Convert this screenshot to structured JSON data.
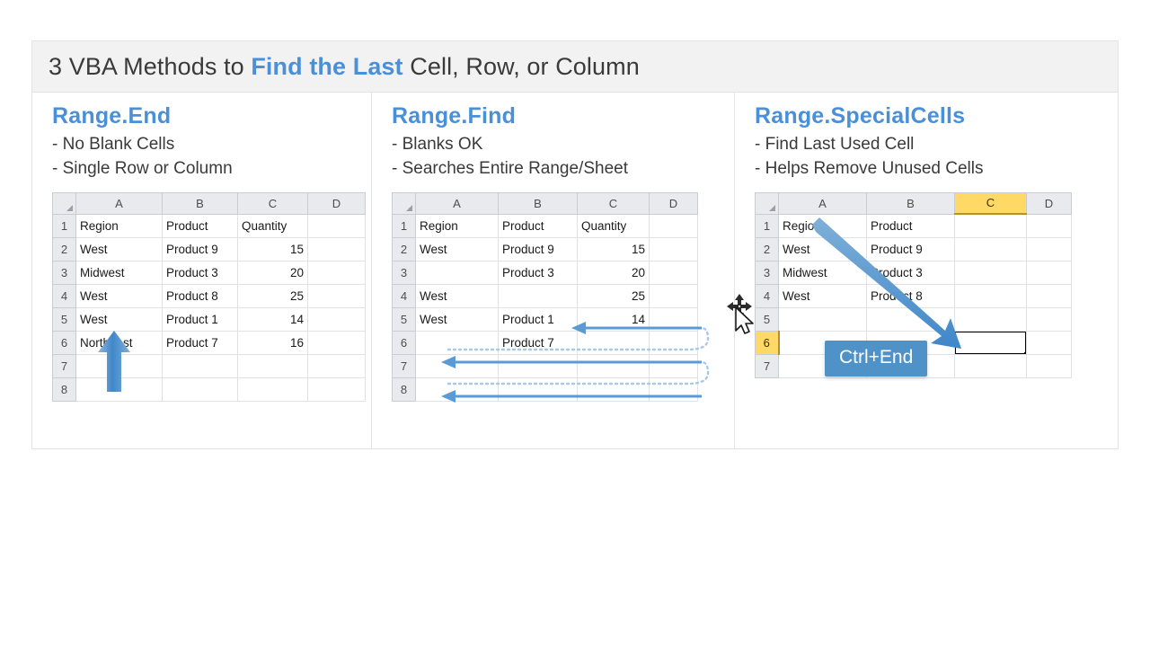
{
  "header": {
    "title_part1": "3 VBA Methods to ",
    "title_highlight": "Find the Last",
    "title_part2": " Cell, Row, or Column"
  },
  "panels": [
    {
      "id": "range-end",
      "title": "Range.End",
      "bullets": [
        "- No Blank Cells",
        "- Single Row or Column"
      ],
      "sheet": {
        "columns": [
          "A",
          "B",
          "C",
          "D"
        ],
        "rows": [
          "1",
          "2",
          "3",
          "4",
          "5",
          "6",
          "7",
          "8"
        ],
        "cells": [
          [
            "Region",
            "Product",
            "Quantity",
            ""
          ],
          [
            "West",
            "Product 9",
            "15",
            ""
          ],
          [
            "Midwest",
            "Product 3",
            "20",
            ""
          ],
          [
            "West",
            "Product 8",
            "25",
            ""
          ],
          [
            "West",
            "Product 1",
            "14",
            ""
          ],
          [
            "Northeast",
            "Product 7",
            "16",
            ""
          ],
          [
            "",
            "",
            "",
            ""
          ],
          [
            "",
            "",
            "",
            ""
          ]
        ]
      },
      "annotation": "up-arrow-column-a"
    },
    {
      "id": "range-find",
      "title": "Range.Find",
      "bullets": [
        "- Blanks OK",
        "- Searches Entire Range/Sheet"
      ],
      "sheet": {
        "columns": [
          "A",
          "B",
          "C",
          "D"
        ],
        "rows": [
          "1",
          "2",
          "3",
          "4",
          "5",
          "6",
          "7",
          "8"
        ],
        "cells": [
          [
            "Region",
            "Product",
            "Quantity",
            ""
          ],
          [
            "West",
            "Product 9",
            "15",
            ""
          ],
          [
            "",
            "Product 3",
            "20",
            ""
          ],
          [
            "West",
            "",
            "25",
            ""
          ],
          [
            "West",
            "Product 1",
            "14",
            ""
          ],
          [
            "",
            "Product 7",
            "",
            ""
          ],
          [
            "",
            "",
            "",
            ""
          ],
          [
            "",
            "",
            "",
            ""
          ]
        ]
      },
      "annotation": "wrapping-search-arrows"
    },
    {
      "id": "range-specialcells",
      "title": "Range.SpecialCells",
      "bullets": [
        "- Find Last Used Cell",
        "- Helps Remove Unused Cells"
      ],
      "sheet": {
        "columns": [
          "A",
          "B",
          "C",
          "D"
        ],
        "rows": [
          "1",
          "2",
          "3",
          "4",
          "5",
          "6",
          "7"
        ],
        "selected_column": "C",
        "selected_row": "6",
        "selected_cell": "C6",
        "cells": [
          [
            "Region",
            "Product",
            "",
            ""
          ],
          [
            "West",
            "Product 9",
            "",
            ""
          ],
          [
            "Midwest",
            "Product 3",
            "",
            ""
          ],
          [
            "West",
            "Product 8",
            "",
            ""
          ],
          [
            "",
            "",
            "",
            ""
          ],
          [
            "",
            "",
            "",
            ""
          ],
          [
            "",
            "",
            "",
            ""
          ]
        ]
      },
      "badge_label": "Ctrl+End",
      "annotation": "diagonal-arrow-to-c6"
    }
  ],
  "colors": {
    "accent_blue": "#4a90d9",
    "arrow_blue": "#5b9bd5",
    "badge_blue": "#4f92c8",
    "highlight_yellow": "#ffd966",
    "header_gray": "#f2f2f2",
    "grid_line": "#e0e2e6"
  },
  "cursor": {
    "type": "move-cursor"
  }
}
